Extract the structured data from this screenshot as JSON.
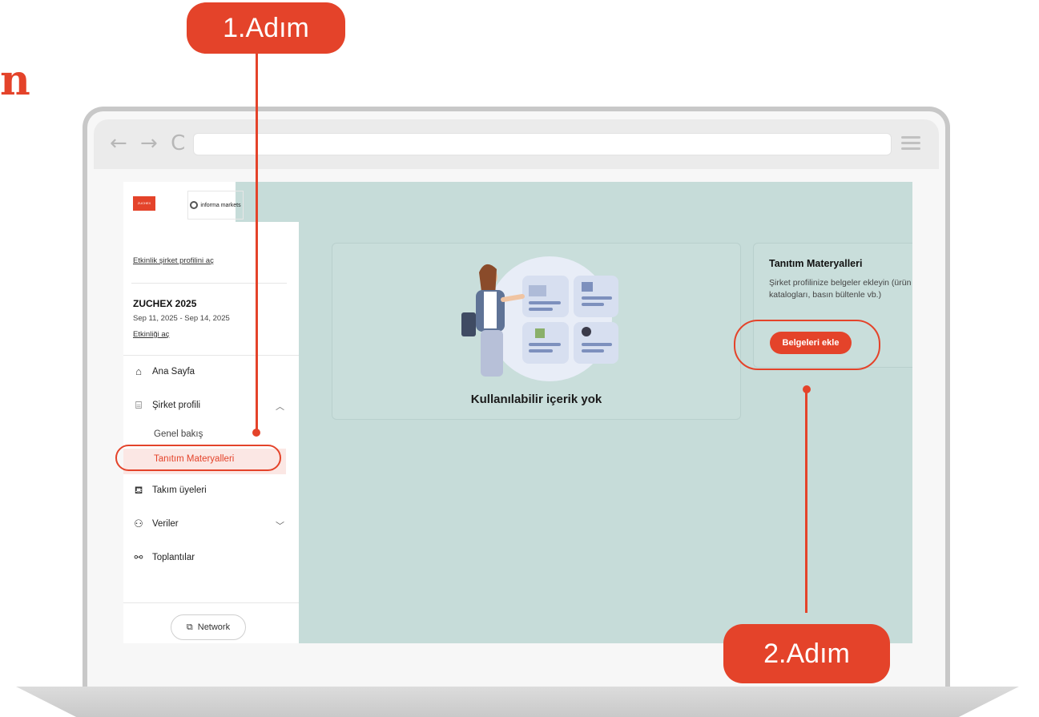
{
  "annotations": {
    "step1": "1.Adım",
    "step2": "2.Adım",
    "corner_glyph": "n"
  },
  "browser": {
    "nav_icons": "← → C",
    "address": ""
  },
  "logos": {
    "left": "ZUCHEX",
    "right": "informa markets"
  },
  "sidebar": {
    "profile_link": "Etkinlik şirket profilini aç",
    "event": {
      "name": "ZUCHEX 2025",
      "dates": "Sep 11, 2025 - Sep 14, 2025",
      "open_link": "Etkinliği aç"
    },
    "items": [
      {
        "label": "Ana Sayfa",
        "icon": "home-icon"
      },
      {
        "label": "Şirket profili",
        "icon": "store-icon"
      },
      {
        "label": "Takım üyeleri",
        "icon": "team-icon"
      },
      {
        "label": "Veriler",
        "icon": "users-icon"
      },
      {
        "label": "Toplantılar",
        "icon": "meeting-icon"
      }
    ],
    "sub_items": [
      {
        "label": "Genel bakış"
      },
      {
        "label": "Tanıtım Materyalleri"
      }
    ],
    "network_label": "Network"
  },
  "main": {
    "empty_text": "Kullanılabilir içerik yok",
    "card": {
      "title": "Tanıtım Materyalleri",
      "description": "Şirket profilinize belgeler ekleyin (ürün katalogları, basın bültenle vb.)",
      "button": "Belgeleri ekle"
    }
  },
  "colors": {
    "accent": "#e4432a",
    "app_background": "#c6dcd9"
  }
}
